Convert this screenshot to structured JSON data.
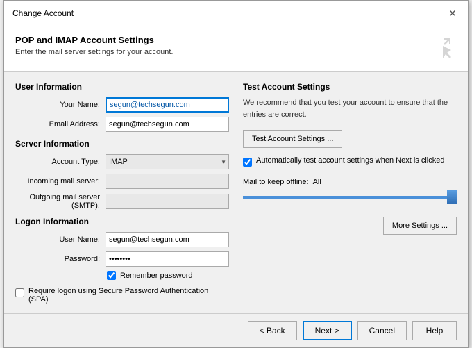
{
  "dialog": {
    "title": "Change Account",
    "close_label": "✕"
  },
  "header": {
    "title": "POP and IMAP Account Settings",
    "description": "Enter the mail server settings for your account."
  },
  "left": {
    "user_info_label": "User Information",
    "your_name_label": "Your Name:",
    "your_name_value": "segun@techsegun.com",
    "email_address_label": "Email Address:",
    "email_address_value": "segun@techsegun.com",
    "server_info_label": "Server Information",
    "account_type_label": "Account Type:",
    "account_type_value": "IMAP",
    "incoming_mail_label": "Incoming mail server:",
    "incoming_mail_value": "",
    "outgoing_mail_label": "Outgoing mail server (SMTP):",
    "outgoing_mail_value": "",
    "logon_info_label": "Logon Information",
    "user_name_label": "User Name:",
    "user_name_value": "segun@techsegun.com",
    "password_label": "Password:",
    "password_value": "••••••••",
    "remember_password_label": "Remember password",
    "remember_password_checked": true,
    "spa_label": "Require logon using Secure Password Authentication (SPA)",
    "spa_checked": false
  },
  "right": {
    "title": "Test Account Settings",
    "description": "We recommend that you test your account to ensure that the entries are correct.",
    "test_btn_label": "Test Account Settings ...",
    "auto_test_label": "Automatically test account settings when Next is clicked",
    "auto_test_checked": true,
    "offline_label": "Mail to keep offline:",
    "offline_value": "All",
    "more_settings_label": "More Settings ..."
  },
  "footer": {
    "back_label": "< Back",
    "next_label": "Next >",
    "cancel_label": "Cancel",
    "help_label": "Help"
  }
}
